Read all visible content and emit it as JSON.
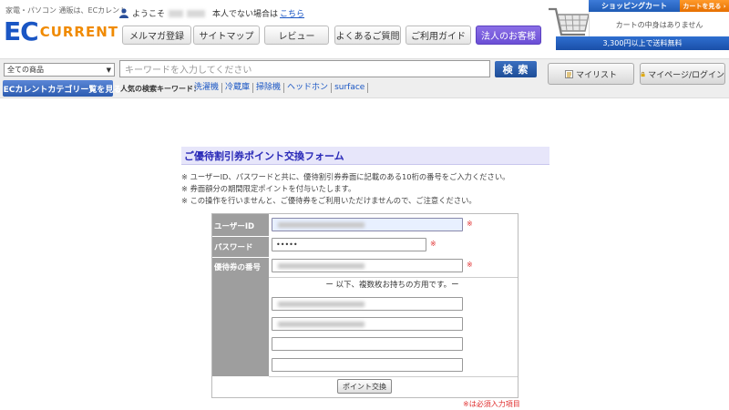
{
  "header": {
    "tagline": "家電・パソコン 通販は、ECカレント",
    "logo_ec": "EC",
    "logo_current": "CURRENT",
    "welcome_prefix": "ようこそ",
    "not_you_text": "本人でない場合は",
    "not_you_link": "こちら",
    "nav": [
      "メルマガ登録",
      "サイトマップ",
      "レビュー",
      "よくあるご質問",
      "ご利用ガイド",
      "法人のお客様"
    ]
  },
  "cart": {
    "title": "ショッピングカート",
    "view_button": "カートを見る ›",
    "empty_text": "カートの中身はありません",
    "free_shipping": "3,300円以上で送料無料"
  },
  "search": {
    "category_selected": "全ての商品",
    "placeholder": "キーワードを入力してください",
    "button": "検 索",
    "category_list_button": "▼ ECカレントカテゴリー覧を見る",
    "popular_label": "人気の検索キーワード：",
    "keywords": [
      "洗濯機",
      "冷蔵庫",
      "掃除機",
      "ヘッドホン",
      "surface"
    ]
  },
  "account": {
    "mylist": "マイリスト",
    "login": "マイページ/ログイン"
  },
  "form": {
    "title": "ご優待割引券ポイント交換フォーム",
    "notes": [
      "※ ユーザーID、パスワードと共に、優待割引券券面に記載のある10桁の番号をご入力ください。",
      "※ 券面額分の期間限定ポイントを付与いたします。",
      "※ この操作を行いませんと、ご優待券をご利用いただけませんので、ご注意ください。"
    ],
    "labels": {
      "user_id": "ユーザーID",
      "password": "パスワード",
      "coupon_number": "優待券の番号"
    },
    "password_value": "•••••",
    "required_mark": "※",
    "multi_note": "ー 以下、複数枚お持ちの方用です。ー",
    "submit": "ポイント交換",
    "required_note": "※は必須入力項目"
  }
}
